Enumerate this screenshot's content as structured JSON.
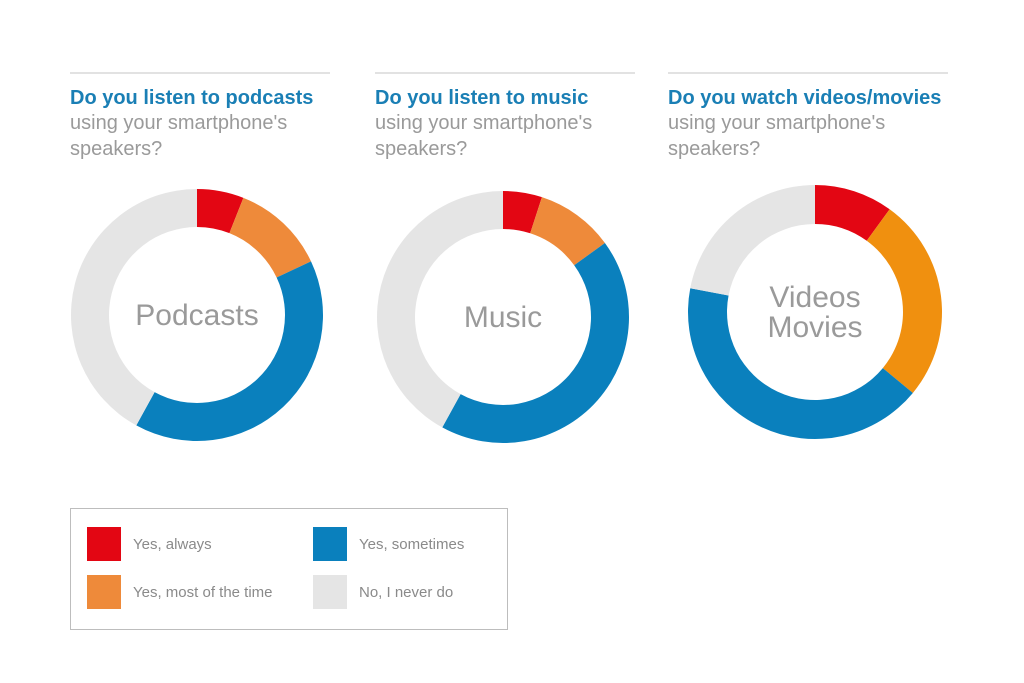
{
  "chart_data": [
    {
      "type": "pie",
      "variant": "donut",
      "center_label": [
        "Podcasts"
      ],
      "title_bold": "Do you listen to podcasts",
      "title_rest": "using your smartphone's speakers?",
      "categories": [
        "Yes, always",
        "Yes, most of the time",
        "Yes, sometimes",
        "No, I never do"
      ],
      "values": [
        6,
        12,
        40,
        42
      ],
      "colors": [
        "#e30613",
        "#ee8a3a",
        "#0a80bd",
        "#e5e5e5"
      ]
    },
    {
      "type": "pie",
      "variant": "donut",
      "center_label": [
        "Music"
      ],
      "title_bold": "Do you listen to music",
      "title_rest": "using your smartphone's speakers?",
      "categories": [
        "Yes, always",
        "Yes, most of the time",
        "Yes, sometimes",
        "No, I never do"
      ],
      "values": [
        5,
        10,
        43,
        42
      ],
      "colors": [
        "#e30613",
        "#ee8a3a",
        "#0a80bd",
        "#e5e5e5"
      ]
    },
    {
      "type": "pie",
      "variant": "donut",
      "center_label": [
        "Videos",
        "Movies"
      ],
      "title_bold": "Do you watch videos/movies",
      "title_rest": "using your smartphone's speakers?",
      "categories": [
        "Yes, always",
        "Yes, most of the time",
        "Yes, sometimes",
        "No, I never do"
      ],
      "values": [
        10,
        26,
        42,
        22
      ],
      "colors": [
        "#e30613",
        "#f0900f",
        "#0a80bd",
        "#e5e5e5"
      ]
    }
  ],
  "legend": [
    {
      "label": "Yes, always",
      "color": "#e30613"
    },
    {
      "label": "Yes, most of the time",
      "color": "#ee8a3a"
    },
    {
      "label": "Yes, sometimes",
      "color": "#0a80bd"
    },
    {
      "label": "No, I never do",
      "color": "#e5e5e5"
    }
  ]
}
